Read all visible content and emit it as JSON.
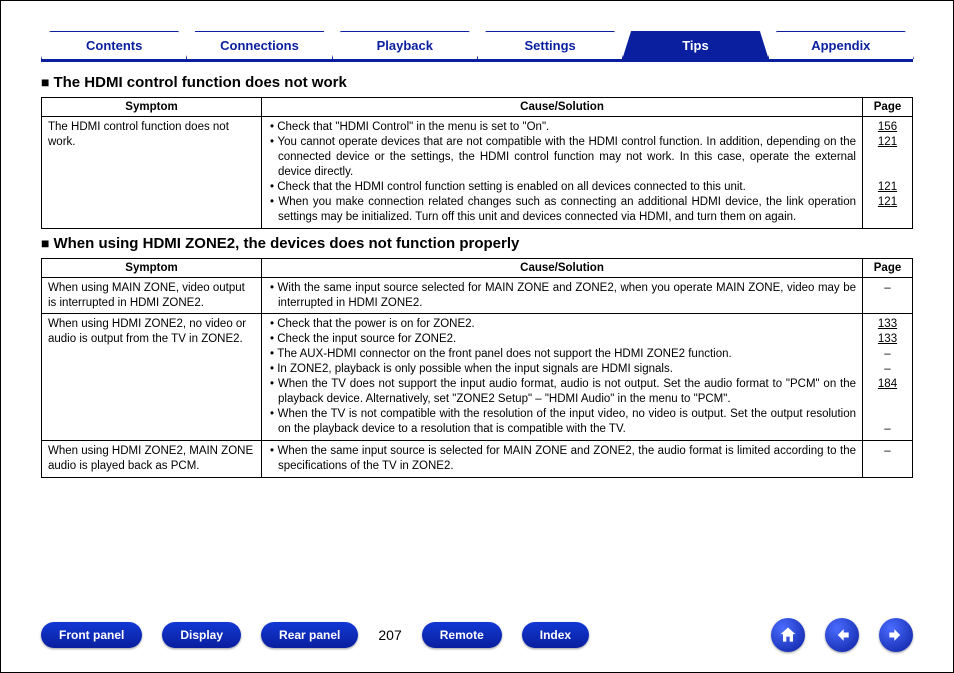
{
  "tabs": [
    {
      "label": "Contents",
      "active": false
    },
    {
      "label": "Connections",
      "active": false
    },
    {
      "label": "Playback",
      "active": false
    },
    {
      "label": "Settings",
      "active": false
    },
    {
      "label": "Tips",
      "active": true
    },
    {
      "label": "Appendix",
      "active": false
    }
  ],
  "headers": {
    "symptom": "Symptom",
    "cause": "Cause/Solution",
    "page": "Page"
  },
  "section1": {
    "title": "The HDMI control function does not work",
    "rows": [
      {
        "symptom": "The HDMI control function does not work.",
        "causes": [
          "Check that \"HDMI Control\" in the menu is set to \"On\".",
          "You cannot operate devices that are not compatible with the HDMI control function. In addition, depending on the connected device or the settings, the HDMI control function may not work. In this case, operate the external device directly.",
          "Check that the HDMI control function setting is enabled on all devices connected to this unit.",
          "When you make connection related changes such as connecting an additional HDMI device, the link operation settings may be initialized. Turn off this unit and devices connected via HDMI, and turn them on again."
        ],
        "pages": [
          "156",
          "121",
          "",
          "",
          "121",
          "121",
          "",
          ""
        ]
      }
    ]
  },
  "section2": {
    "title": "When using HDMI ZONE2, the devices does not function properly",
    "rows": [
      {
        "symptom": "When using MAIN ZONE, video output is interrupted in HDMI ZONE2.",
        "causes": [
          "With the same input source selected for MAIN ZONE and ZONE2, when you operate MAIN ZONE, video may be interrupted in HDMI ZONE2."
        ],
        "pages": [
          "–"
        ]
      },
      {
        "symptom": "When using HDMI ZONE2, no video or audio is output from the TV in ZONE2.",
        "causes": [
          "Check that the power is on for ZONE2.",
          "Check the input source for ZONE2.",
          "The AUX-HDMI connector on the front panel does not support the HDMI ZONE2 function.",
          "In ZONE2, playback is only possible when the input signals are HDMI signals.",
          "When the TV does not support the input audio format, audio is not output. Set the audio format to \"PCM\" on the playback device. Alternatively, set \"ZONE2 Setup\" – \"HDMI Audio\" in the menu to \"PCM\".",
          "When the TV is not compatible with the resolution of the input video, no video is output. Set the output resolution on the playback device to a resolution that is compatible with the TV."
        ],
        "pages": [
          "133",
          "133",
          "–",
          "–",
          "184",
          "",
          "",
          "–"
        ]
      },
      {
        "symptom": "When using HDMI ZONE2, MAIN ZONE audio is played back as PCM.",
        "causes": [
          "When the same input source is selected for MAIN ZONE and ZONE2, the audio format is limited according to the specifications of the TV in ZONE2."
        ],
        "pages": [
          "–"
        ]
      }
    ]
  },
  "footer": {
    "pills": [
      "Front panel",
      "Display",
      "Rear panel"
    ],
    "page_number": "207",
    "pills2": [
      "Remote",
      "Index"
    ],
    "icons": [
      "home-icon",
      "prev-icon",
      "next-icon"
    ]
  }
}
